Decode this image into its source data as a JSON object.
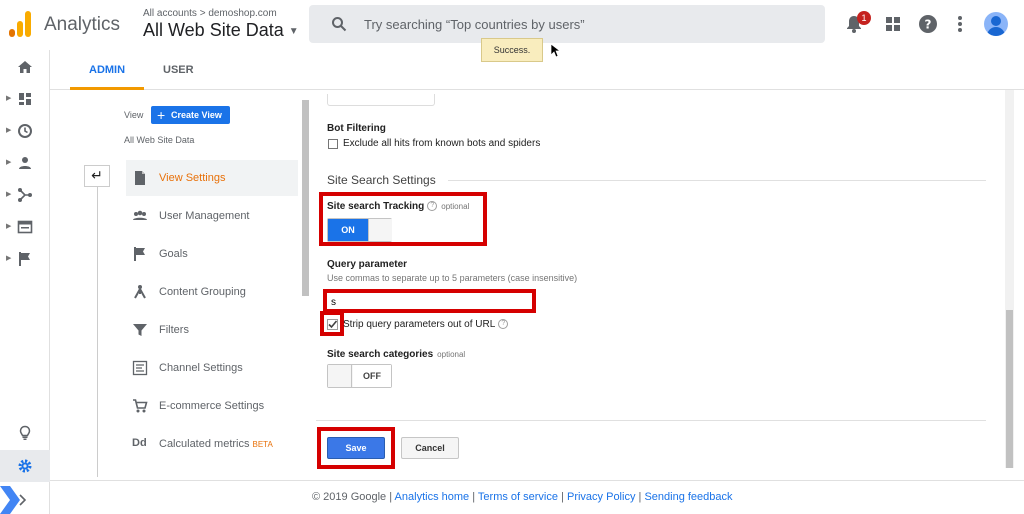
{
  "header": {
    "app_name": "Analytics",
    "account_breadcrumb": "All accounts > demoshop.com",
    "property_title": "All Web Site Data",
    "search_placeholder": "Try searching “Top countries by users”",
    "notification_count": "1",
    "toast": "Success."
  },
  "colors": {
    "brand_orange": "#f9ab00",
    "brand_orange_dark": "#e37400",
    "primary_blue": "#1a73e8",
    "highlight_red": "#d50000",
    "selected_nav": "#e8710a"
  },
  "rail": {
    "icons": [
      "home-icon",
      "dashboard-icon",
      "clock-icon",
      "person-icon",
      "acquisition-icon",
      "behavior-icon",
      "flag-icon",
      "lightbulb-icon",
      "gear-icon",
      "expand-icon"
    ]
  },
  "tabs": [
    {
      "label": "ADMIN",
      "active": true
    },
    {
      "label": "USER",
      "active": false
    }
  ],
  "nav": {
    "view_label": "View",
    "create_view": "Create View",
    "view_name": "All Web Site Data",
    "items": [
      {
        "label": "View Settings",
        "icon": "document-icon",
        "selected": true
      },
      {
        "label": "User Management",
        "icon": "people-icon",
        "selected": false
      },
      {
        "label": "Goals",
        "icon": "flag-icon",
        "selected": false
      },
      {
        "label": "Content Grouping",
        "icon": "grouping-icon",
        "selected": false
      },
      {
        "label": "Filters",
        "icon": "filter-icon",
        "selected": false
      },
      {
        "label": "Channel Settings",
        "icon": "channel-icon",
        "selected": false
      },
      {
        "label": "E-commerce Settings",
        "icon": "cart-icon",
        "selected": false
      },
      {
        "label": "Calculated metrics",
        "icon": "dd-icon",
        "selected": false,
        "badge": "BETA"
      }
    ]
  },
  "settings": {
    "bot_filtering": {
      "title": "Bot Filtering",
      "checkbox_label": "Exclude all hits from known bots and spiders",
      "checked": false
    },
    "section_title": "Site Search Settings",
    "site_search_tracking": {
      "title": "Site search Tracking",
      "optional": "optional",
      "toggle_label": "ON",
      "enabled": true
    },
    "query_parameter": {
      "title": "Query parameter",
      "hint": "Use commas to separate up to 5 parameters (case insensitive)",
      "value": "s",
      "strip_label": "Strip query parameters out of URL",
      "strip_checked": true
    },
    "site_search_categories": {
      "title": "Site search categories",
      "optional": "optional",
      "toggle_label": "OFF",
      "enabled": false
    },
    "save_label": "Save",
    "cancel_label": "Cancel"
  },
  "footer": {
    "copyright": "© 2019 Google",
    "links": [
      "Analytics home",
      "Terms of service",
      "Privacy Policy",
      "Sending feedback"
    ]
  }
}
